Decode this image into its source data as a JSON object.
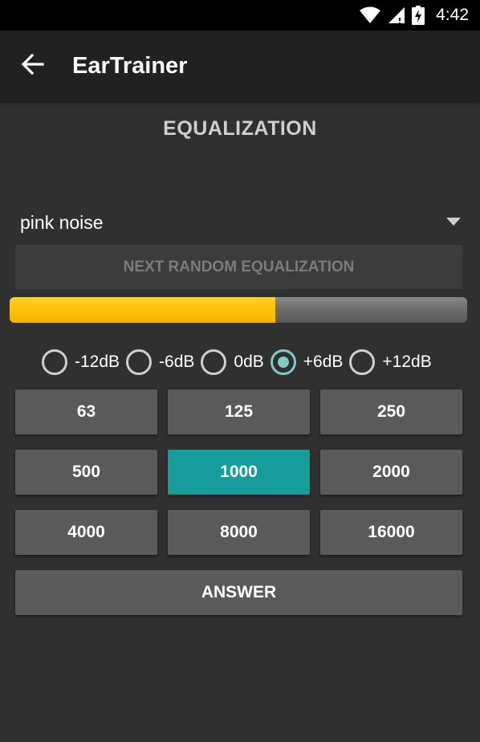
{
  "status_bar": {
    "time": "4:42",
    "icons": [
      "wifi-icon",
      "cell-signal-icon",
      "battery-charging-icon"
    ]
  },
  "toolbar": {
    "back_icon": "arrow-back-icon",
    "title": "EarTrainer"
  },
  "section_title": "EQUALIZATION",
  "spinner": {
    "value": "pink noise",
    "icon": "dropdown-triangle-icon"
  },
  "next_button_label": "NEXT RANDOM EQUALIZATION",
  "progress": {
    "value": 0.58,
    "fill_color": "#ffc107",
    "track_color": "#6d6d6d"
  },
  "gain_options": {
    "items": [
      "-12dB",
      "-6dB",
      "0dB",
      "+6dB",
      "+12dB"
    ],
    "selected": "+6dB"
  },
  "frequency_buttons": {
    "items": [
      "63",
      "125",
      "250",
      "500",
      "1000",
      "2000",
      "4000",
      "8000",
      "16000"
    ],
    "selected": "1000",
    "selected_color": "#169c9a",
    "default_color": "#5a5a5a"
  },
  "answer_button_label": "ANSWER",
  "colors": {
    "background": "#303030",
    "toolbar": "#212121",
    "status_bar": "#000000",
    "radio_accent": "#80cbc4"
  }
}
